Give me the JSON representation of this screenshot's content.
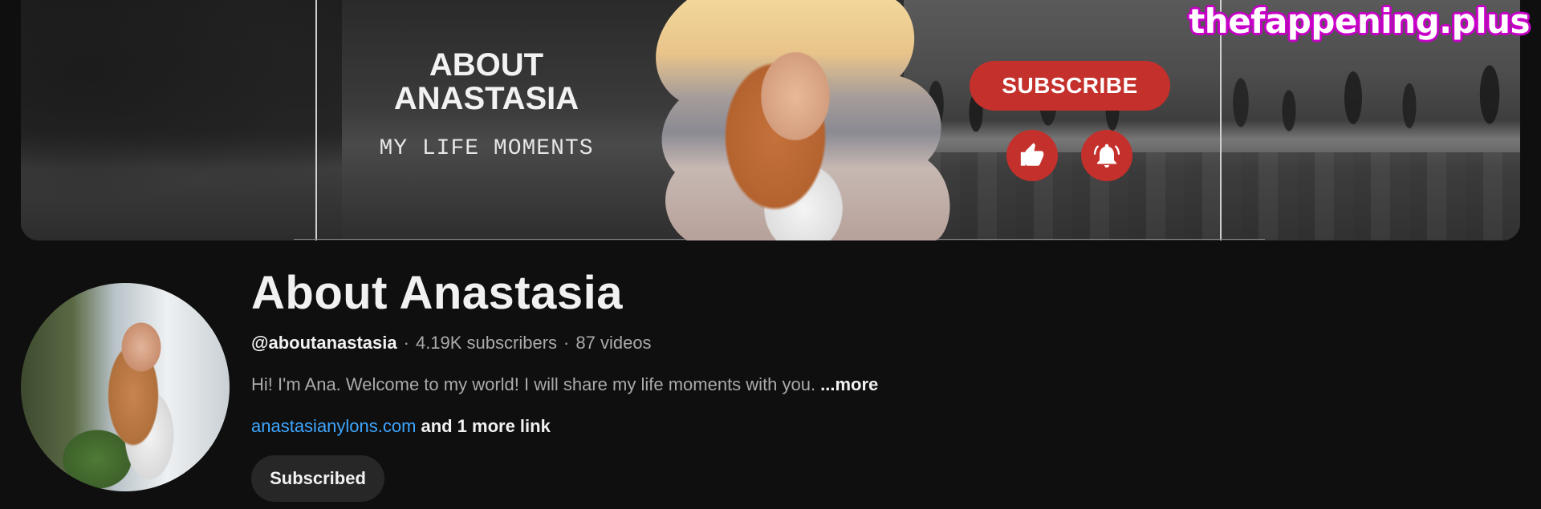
{
  "banner": {
    "title": "ABOUT ANASTASIA",
    "subtitle": "MY LIFE MOMENTS",
    "subscribe_label": "SUBSCRIBE",
    "icons": [
      "thumbs-up-icon",
      "bell-icon"
    ],
    "accent_color": "#c4302b"
  },
  "watermark": "thefappening.plus",
  "channel": {
    "name": "About Anastasia",
    "handle": "@aboutanastasia",
    "subscribers": "4.19K subscribers",
    "videos": "87 videos",
    "description": "Hi! I'm Ana. Welcome to my world! I will share my life moments with you.",
    "more_label": "...more",
    "link": "anastasianylons.com",
    "more_links": "and 1 more link",
    "subscribed_label": "Subscribed"
  },
  "colors": {
    "background": "#0f0f0f",
    "link": "#3ea6ff",
    "secondary_text": "#aaaaaa",
    "button_bg": "#272727"
  }
}
